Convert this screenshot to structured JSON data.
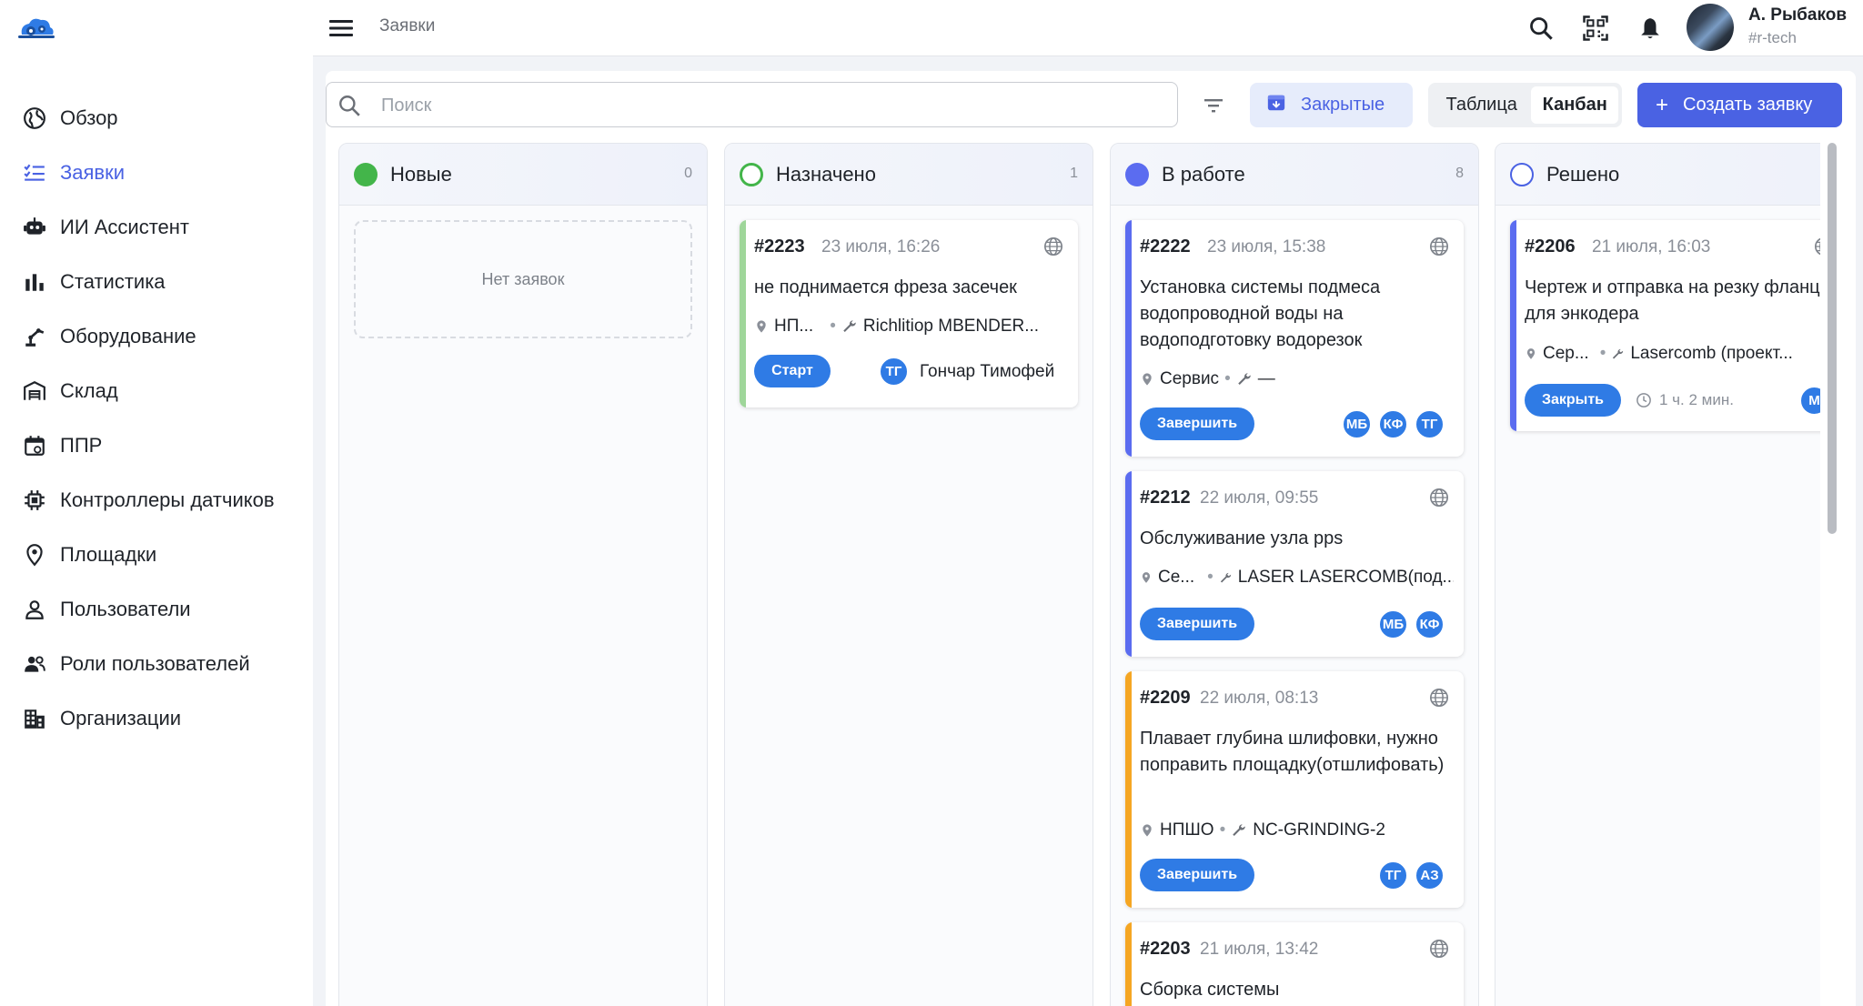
{
  "colors": {
    "accent": "#4a62e3",
    "blue_pill": "#2f7be5",
    "status_new": "#43b54a",
    "status_assigned": "#43b54a",
    "status_inprogress": "#5b6cf0",
    "status_resolved": "#4a62e3",
    "stripe_green": "#9fd69a",
    "stripe_blue": "#5b6cf0",
    "stripe_orange": "#f5a623"
  },
  "sidebar": {
    "items": [
      {
        "label": "Обзор",
        "icon": "globe-icon"
      },
      {
        "label": "Заявки",
        "icon": "checklist-icon",
        "active": true
      },
      {
        "label": "ИИ Ассистент",
        "icon": "robot-icon"
      },
      {
        "label": "Статистика",
        "icon": "bar-chart-icon"
      },
      {
        "label": "Оборудование",
        "icon": "robot-arm-icon"
      },
      {
        "label": "Склад",
        "icon": "warehouse-icon"
      },
      {
        "label": "ППР",
        "icon": "calendar-icon"
      },
      {
        "label": "Контроллеры датчиков",
        "icon": "chip-icon"
      },
      {
        "label": "Площадки",
        "icon": "location-pin-icon"
      },
      {
        "label": "Пользователи",
        "icon": "person-icon"
      },
      {
        "label": "Роли пользователей",
        "icon": "people-icon"
      },
      {
        "label": "Организации",
        "icon": "buildings-icon"
      }
    ]
  },
  "topbar": {
    "breadcrumb": "Заявки",
    "user_name": "А. Рыбаков",
    "user_org": "#r-tech"
  },
  "toolbar": {
    "search_placeholder": "Поиск",
    "closed_label": "Закрытые",
    "view_table": "Таблица",
    "view_kanban": "Канбан",
    "create_label": "Создать заявку"
  },
  "columns": [
    {
      "title": "Новые",
      "count": "0",
      "empty_text": "Нет заявок"
    },
    {
      "title": "Назначено",
      "count": "1"
    },
    {
      "title": "В работе",
      "count": "8"
    },
    {
      "title": "Решено",
      "count": ""
    }
  ],
  "cards": {
    "c2223": {
      "num": "#2223",
      "date": "23 июля, 16:26",
      "desc": "не поднимается фреза засечек",
      "site": "НП...",
      "equipment": "Richlitiop MBENDER...",
      "action": "Старт",
      "assignee_initials": "ТГ",
      "assignee_name": "Гончар Тимофей"
    },
    "c2222": {
      "num": "#2222",
      "date": "23 июля, 15:38",
      "desc": "Установка системы подмеса водопроводной воды на водоподготовку водорезок",
      "site": "Сервис",
      "equipment": "—",
      "action": "Завершить",
      "avatars": [
        "МБ",
        "КФ",
        "ТГ"
      ]
    },
    "c2212": {
      "num": "#2212",
      "date": "22 июля, 09:55",
      "desc": "Обслуживание узла pps",
      "site": "Се...",
      "equipment": "LASER LASERCOMB(под...",
      "action": "Завершить",
      "avatars": [
        "МБ",
        "КФ"
      ]
    },
    "c2209": {
      "num": "#2209",
      "date": "22 июля, 08:13",
      "desc": "Плавает глубина шлифовки, нужно поправить площадку(отшлифовать)",
      "site": "НПШО",
      "equipment": "NC-GRINDING-2",
      "action": "Завершить",
      "avatars": [
        "ТГ",
        "АЗ"
      ]
    },
    "c2203": {
      "num": "#2203",
      "date": "21 июля, 13:42",
      "desc": "Сборка системы"
    },
    "c2206": {
      "num": "#2206",
      "date": "21 июля, 16:03",
      "desc": "Чертеж и отправка на резку фланца для энкодера",
      "site": "Сер...",
      "equipment": "Lasercomb (проект...",
      "action": "Закрыть",
      "timer": "1 ч. 2 мин.",
      "avatar": "М"
    }
  }
}
